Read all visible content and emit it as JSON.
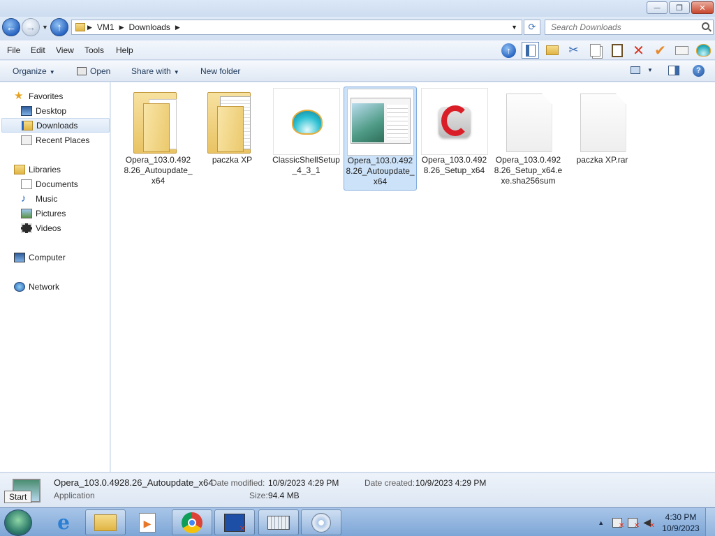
{
  "window": {
    "minimize_glyph": "—",
    "restore_glyph": "❐",
    "close_glyph": "✕"
  },
  "address": {
    "path": [
      "VM1",
      "Downloads"
    ],
    "search_placeholder": "Search Downloads"
  },
  "menu": [
    "File",
    "Edit",
    "View",
    "Tools",
    "Help"
  ],
  "commands": {
    "organize": "Organize",
    "open": "Open",
    "share_with": "Share with",
    "new_folder": "New folder"
  },
  "nav": {
    "favorites": "Favorites",
    "desktop": "Desktop",
    "downloads": "Downloads",
    "recent_places": "Recent Places",
    "libraries": "Libraries",
    "documents": "Documents",
    "music": "Music",
    "pictures": "Pictures",
    "videos": "Videos",
    "computer": "Computer",
    "network": "Network"
  },
  "files": [
    {
      "name": "Opera_103.0.4928.26_Autoupdate_x64",
      "kind": "folder-doc"
    },
    {
      "name": "paczka XP",
      "kind": "folder-doc"
    },
    {
      "name": "ClassicShellSetup_4_3_1",
      "kind": "shell-icon"
    },
    {
      "name": "Opera_103.0.4928.26_Autoupdate_x64",
      "kind": "app-thumb",
      "selected": true
    },
    {
      "name": "Opera_103.0.4928.26_Setup_x64",
      "kind": "opera-icon"
    },
    {
      "name": "Opera_103.0.4928.26_Setup_x64.exe.sha256sum",
      "kind": "blank-file"
    },
    {
      "name": "paczka XP.rar",
      "kind": "blank-file"
    }
  ],
  "details": {
    "name": "Opera_103.0.4928.26_Autoupdate_x64",
    "type": "Application",
    "modified_label": "Date modified:",
    "modified_value": "10/9/2023 4:29 PM",
    "size_label": "Size:",
    "size_value": "94.4 MB",
    "created_label": "Date created:",
    "created_value": "10/9/2023 4:29 PM"
  },
  "start_tooltip": "Start",
  "clock": {
    "time": "4:30 PM",
    "date": "10/9/2023"
  },
  "colors": {
    "accent": "#3a6fb5",
    "selection": "#cce2f8",
    "opera_red": "#d91e27"
  }
}
